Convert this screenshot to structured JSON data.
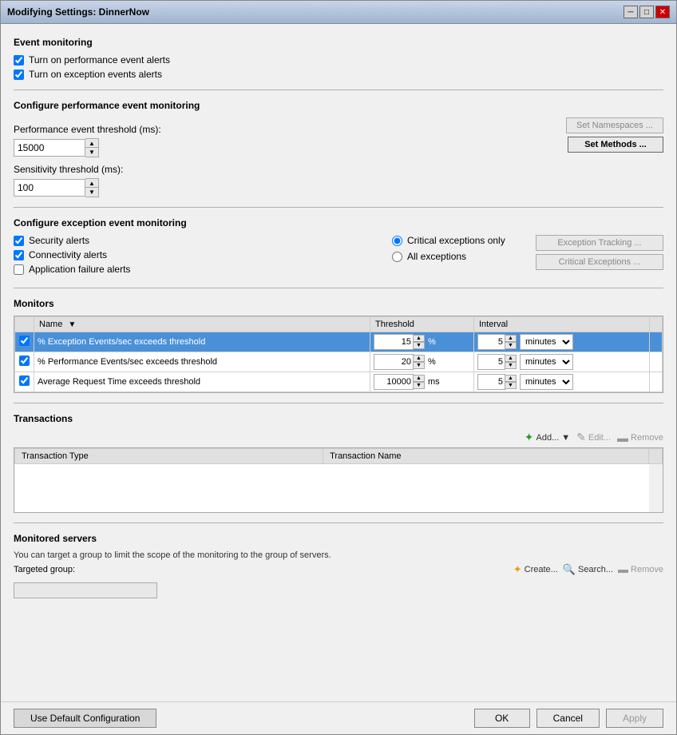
{
  "window": {
    "title": "Modifying Settings: DinnerNow"
  },
  "event_monitoring": {
    "section_title": "Event monitoring",
    "checkbox1_label": "Turn on performance event alerts",
    "checkbox1_checked": true,
    "checkbox2_label": "Turn on exception events alerts",
    "checkbox2_checked": true
  },
  "perf_monitoring": {
    "section_title": "Configure performance event monitoring",
    "threshold_label": "Performance event threshold (ms):",
    "threshold_value": "15000",
    "sensitivity_label": "Sensitivity threshold (ms):",
    "sensitivity_value": "100",
    "btn_set_namespaces": "Set Namespaces ...",
    "btn_set_methods": "Set Methods ..."
  },
  "exception_monitoring": {
    "section_title": "Configure exception event monitoring",
    "checkbox_security": "Security alerts",
    "checkbox_security_checked": true,
    "checkbox_connectivity": "Connectivity alerts",
    "checkbox_connectivity_checked": true,
    "checkbox_appfailure": "Application failure alerts",
    "checkbox_appfailure_checked": false,
    "radio_critical_label": "Critical exceptions only",
    "radio_critical_checked": true,
    "radio_all_label": "All exceptions",
    "radio_all_checked": false,
    "btn_exception_tracking": "Exception Tracking ...",
    "btn_critical_exceptions": "Critical Exceptions ..."
  },
  "monitors": {
    "section_title": "Monitors",
    "table_headers": [
      "",
      "Name",
      "Threshold",
      "Interval"
    ],
    "rows": [
      {
        "checked": true,
        "name": "% Exception Events/sec exceeds threshold",
        "threshold_value": "15",
        "threshold_unit": "%",
        "interval_value": "5",
        "interval_unit": "minutes",
        "selected": true
      },
      {
        "checked": true,
        "name": "% Performance Events/sec exceeds threshold",
        "threshold_value": "20",
        "threshold_unit": "%",
        "interval_value": "5",
        "interval_unit": "minutes",
        "selected": false
      },
      {
        "checked": true,
        "name": "Average Request Time exceeds threshold",
        "threshold_value": "10000",
        "threshold_unit": "ms",
        "interval_value": "5",
        "interval_unit": "minutes",
        "selected": false
      }
    ]
  },
  "transactions": {
    "section_title": "Transactions",
    "btn_add": "Add...",
    "btn_edit": "Edit...",
    "btn_remove": "Remove",
    "table_headers": [
      "Transaction Type",
      "Transaction Name"
    ]
  },
  "monitored_servers": {
    "section_title": "Monitored servers",
    "description": "You can target a group to limit the scope of the monitoring to the group of servers.",
    "targeted_group_label": "Targeted group:",
    "btn_create": "Create...",
    "btn_search": "Search...",
    "btn_remove": "Remove"
  },
  "footer": {
    "btn_use_default": "Use Default Configuration",
    "btn_ok": "OK",
    "btn_cancel": "Cancel",
    "btn_apply": "Apply"
  }
}
